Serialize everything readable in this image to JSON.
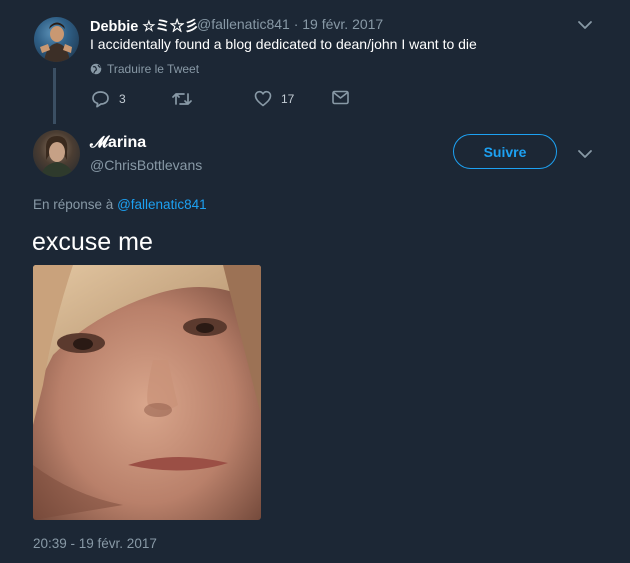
{
  "reply_tweet": {
    "display_name": "Debbie ☆ミ☆彡",
    "handle_date": "@fallenatic841 · 19 févr. 2017",
    "text": "I accidentally found a blog dedicated to dean/john I want to die",
    "translate_label": "Traduire le Tweet",
    "reply_count": "3",
    "like_count": "17",
    "icons": {
      "more": "chevron-down-icon",
      "translate": "globe-icon",
      "reply": "reply-icon",
      "retweet": "retweet-icon",
      "like": "heart-icon",
      "dm": "envelope-icon"
    }
  },
  "main_tweet": {
    "display_name": "𝓜arina",
    "handle": "@ChrisBottlevans",
    "follow_label": "Suivre",
    "in_reply_prefix": "En réponse à",
    "in_reply_handle": "@fallenatic841",
    "text": "excuse me",
    "media_description": "close-up photo of a woman's face",
    "timestamp": "20:39 - 19 févr. 2017"
  },
  "colors": {
    "background": "#1c2735",
    "text": "#ffffff",
    "muted": "#8899a6",
    "accent": "#1da1f2"
  }
}
